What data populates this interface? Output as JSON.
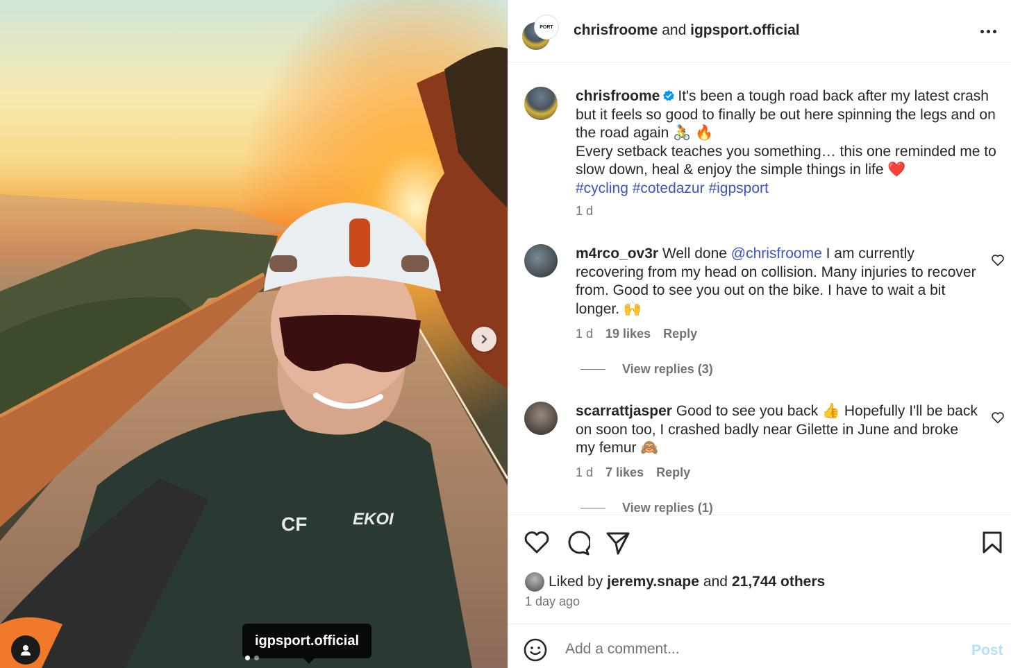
{
  "photo": {
    "tag_label": "igpsport.official",
    "jersey_initials": "CF",
    "jersey_brand": "EKOI",
    "carousel": {
      "current": 1,
      "total": 2
    }
  },
  "header": {
    "user1": "chrisfroome",
    "joiner": "and",
    "user2": "igpsport.official",
    "collab_avatar_text": "PORT"
  },
  "caption": {
    "username": "chrisfroome",
    "text_line1": "It's been a tough road back after my latest crash but it feels so good to finally be out here spinning the legs and on the road again 🚴 🔥",
    "text_line2": "Every setback teaches you something… this one reminded me to slow down, heal & enjoy the simple things in life ❤️",
    "hashtags": "#cycling #cotedazur #igpsport",
    "time": "1 d"
  },
  "comments": [
    {
      "username": "m4rco_ov3r",
      "pre": "Well done ",
      "mention": "@chrisfroome",
      "post": " I am currently recovering from my head on collision. Many injuries to recover from. Good to see you out on the bike. I have to wait a bit longer. 🙌",
      "time": "1 d",
      "likes": "19 likes",
      "reply": "Reply",
      "view_replies": "View replies (3)"
    },
    {
      "username": "scarrattjasper",
      "pre": "Good to see you back 👍 Hopefully I'll be back on soon too, I crashed badly near Gilette in June and broke my femur 🙈",
      "time": "1 d",
      "likes": "7 likes",
      "reply": "Reply",
      "view_replies": "View replies (1)"
    }
  ],
  "likes": {
    "prefix": "Liked by",
    "user": "jeremy.snape",
    "joiner": "and",
    "others": "21,744 others",
    "time_ago": "1 day ago"
  },
  "composer": {
    "placeholder": "Add a comment...",
    "post_label": "Post"
  },
  "colors": {
    "link": "#3a53c5",
    "muted": "#737373",
    "post_disabled": "#b2dffc",
    "verified": "#0095f6"
  },
  "icons": [
    "chevron-right-icon",
    "user-icon",
    "more-icon",
    "verified-icon",
    "heart-icon",
    "comment-icon",
    "share-icon",
    "bookmark-icon",
    "emoji-icon"
  ]
}
